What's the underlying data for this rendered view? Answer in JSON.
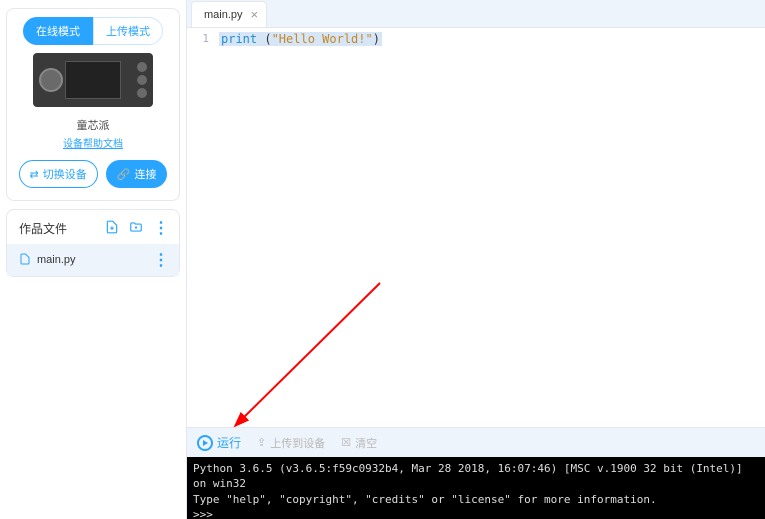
{
  "sidebar": {
    "mode_tabs": {
      "online": "在线模式",
      "upload": "上传模式"
    },
    "device": {
      "name": "童芯派",
      "help_link": "设备帮助文档"
    },
    "buttons": {
      "switch": "切换设备",
      "connect": "连接"
    },
    "files": {
      "heading": "作品文件",
      "items": [
        "main.py"
      ]
    }
  },
  "editor": {
    "tab_name": "main.py",
    "code": {
      "func": "print",
      "open": " (",
      "string": "\"Hello World!\"",
      "close": ")"
    }
  },
  "actions": {
    "run": "运行",
    "upload": "上传到设备",
    "clear": "清空"
  },
  "terminal": {
    "line1": "Python 3.6.5 (v3.6.5:f59c0932b4, Mar 28 2018, 16:07:46) [MSC v.1900 32 bit (Intel)] on win32",
    "line2": "Type \"help\", \"copyright\", \"credits\" or \"license\" for more information.",
    "prompt": ">>>"
  }
}
